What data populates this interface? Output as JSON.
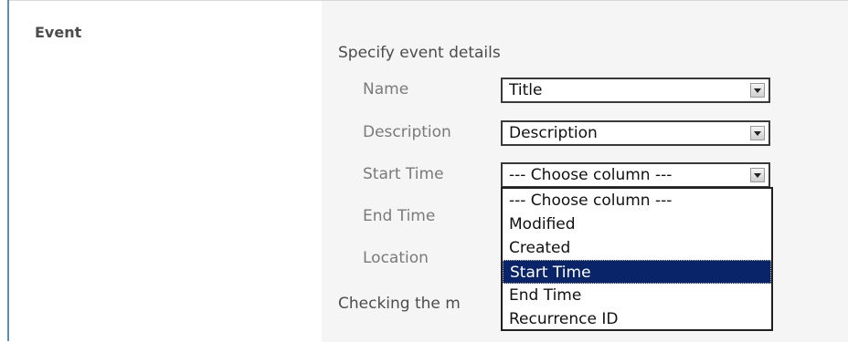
{
  "section": {
    "title": "Event"
  },
  "form": {
    "intro": "Specify event details",
    "fields": [
      {
        "label": "Name",
        "value": "Title"
      },
      {
        "label": "Description",
        "value": "Description"
      },
      {
        "label": "Start Time",
        "value": "--- Choose column ---"
      },
      {
        "label": "End Time"
      },
      {
        "label": "Location"
      }
    ],
    "footer_partial": "Checking the m"
  },
  "dropdown": {
    "options": [
      "--- Choose column ---",
      "Modified",
      "Created",
      "Start Time",
      "End Time",
      "Recurrence ID"
    ],
    "highlighted": "Start Time"
  },
  "colors": {
    "highlight_bg": "#0a246a",
    "left_rule": "#5a8fb8",
    "field_panel_bg": "#f5f5f5"
  }
}
